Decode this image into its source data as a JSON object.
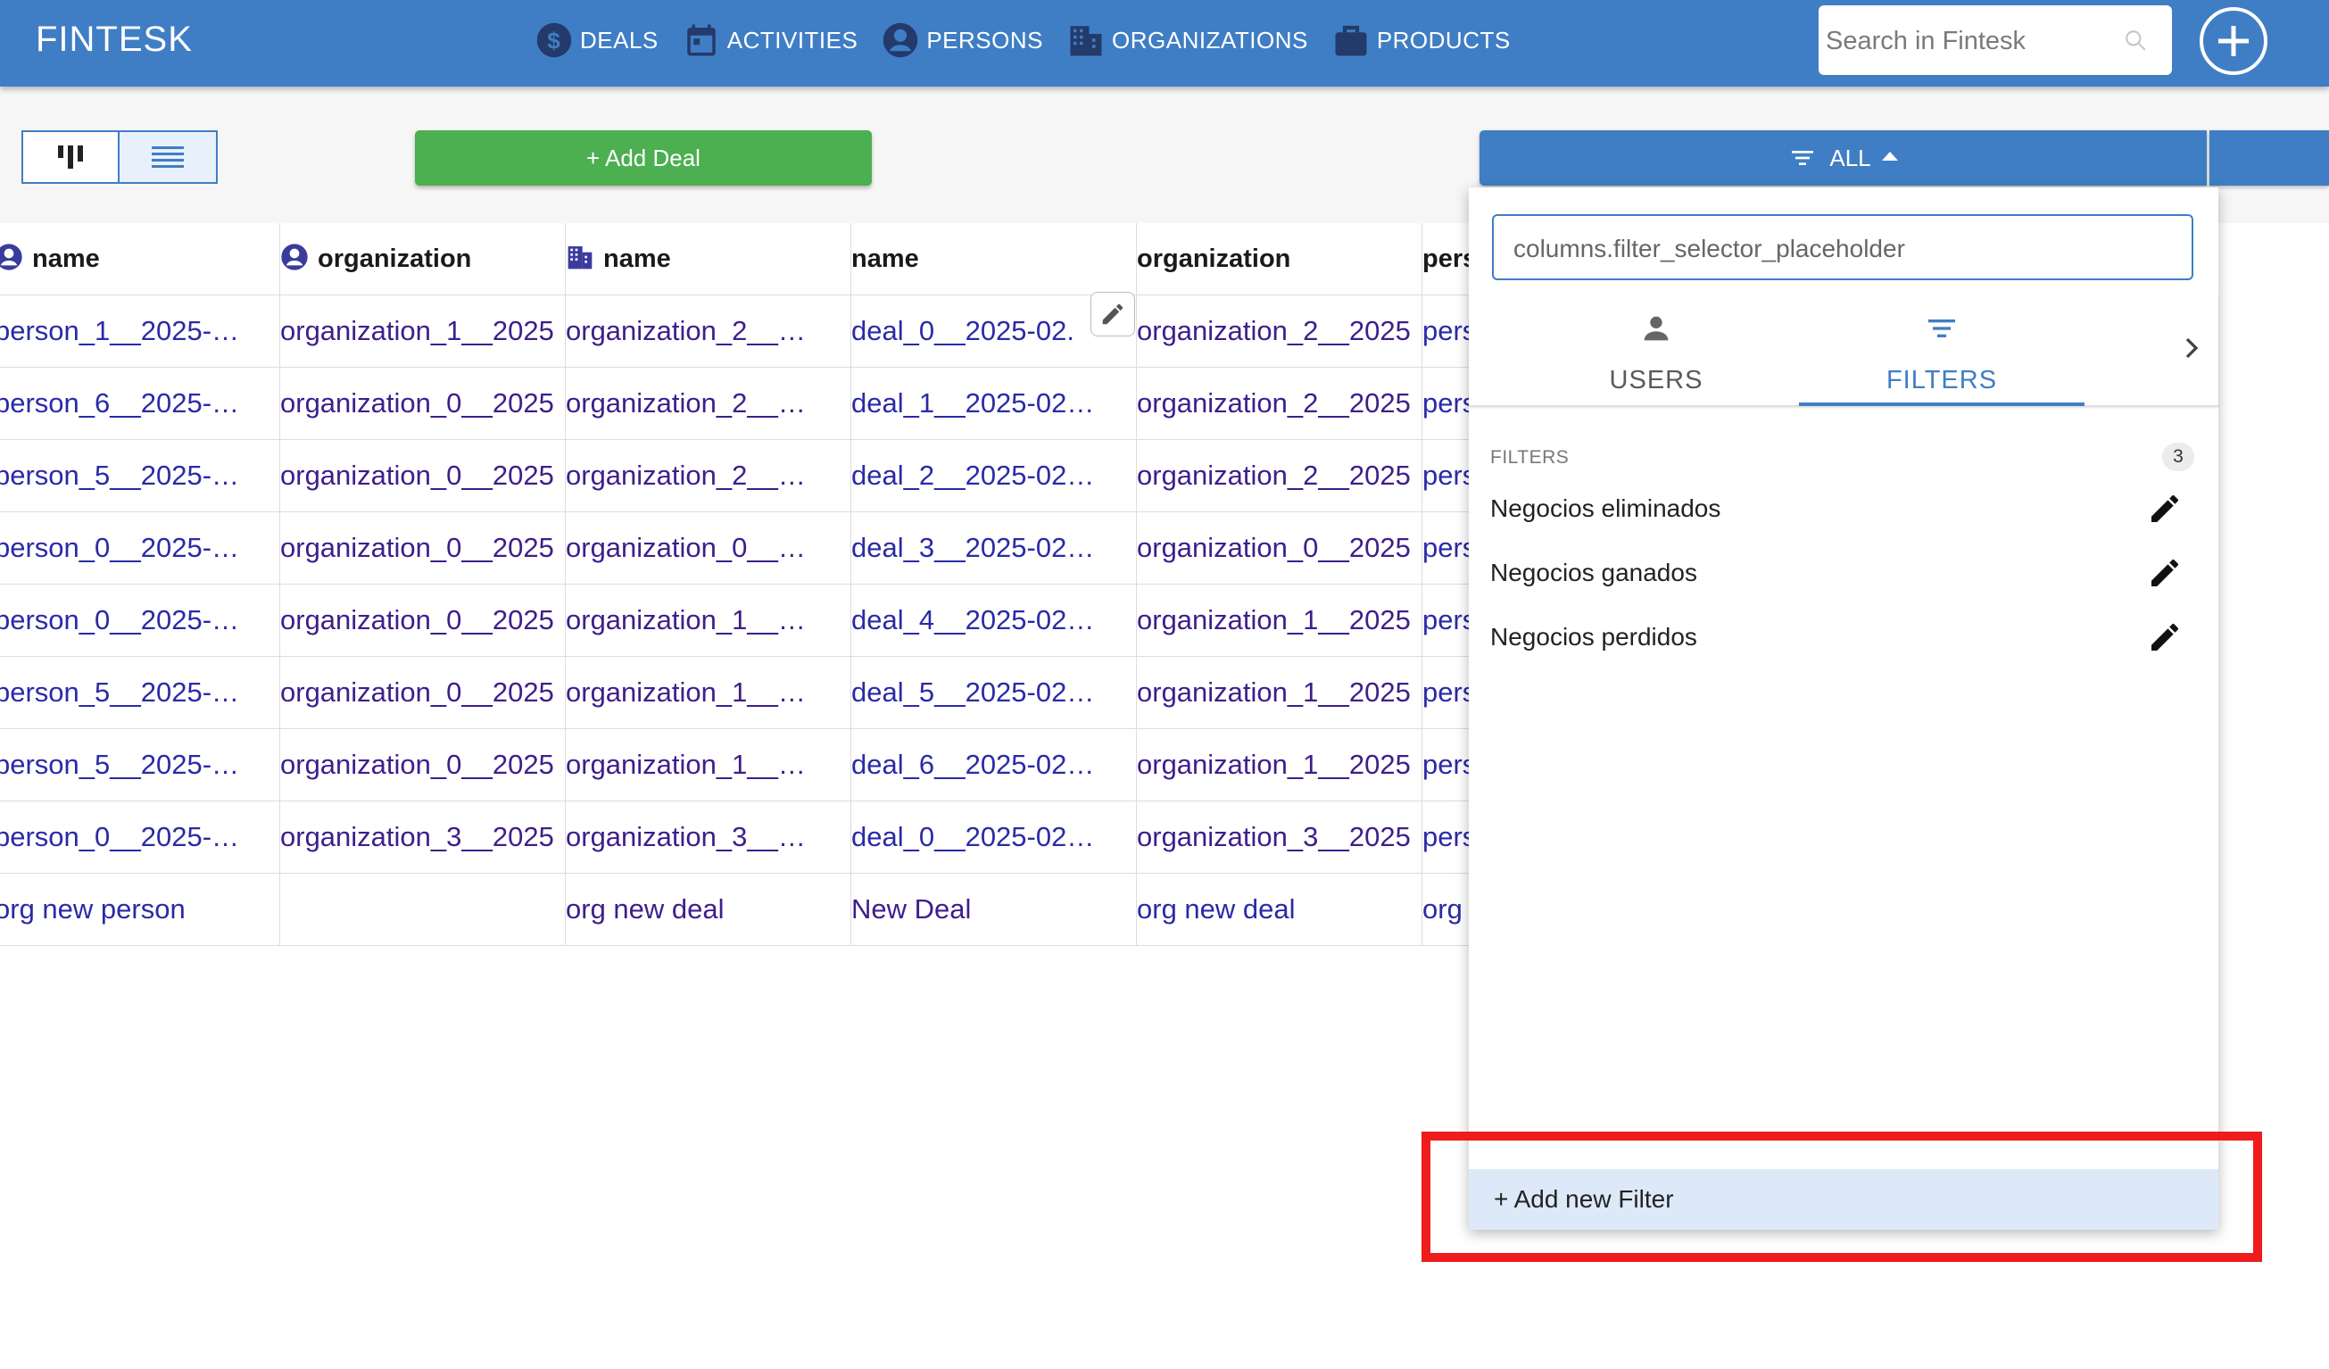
{
  "app": {
    "brand": "FINTESK"
  },
  "nav": [
    {
      "label": "DEALS",
      "icon": "dollar-circle-icon"
    },
    {
      "label": "ACTIVITIES",
      "icon": "calendar-icon"
    },
    {
      "label": "PERSONS",
      "icon": "person-circle-icon"
    },
    {
      "label": "ORGANIZATIONS",
      "icon": "building-icon"
    },
    {
      "label": "PRODUCTS",
      "icon": "briefcase-icon"
    }
  ],
  "search": {
    "placeholder": "Search in Fintesk"
  },
  "toolbar": {
    "add_deal_label": "+ Add Deal",
    "filter_label": "ALL"
  },
  "table": {
    "headers": [
      "name",
      "organization",
      "name",
      "name",
      "organization",
      "pers"
    ],
    "rows": [
      [
        "person_1__2025-…",
        "organization_1__2025",
        "organization_2__…",
        "deal_0__2025-02.",
        "organization_2__2025",
        "pers"
      ],
      [
        "person_6__2025-…",
        "organization_0__2025",
        "organization_2__…",
        "deal_1__2025-02…",
        "organization_2__2025",
        "pers"
      ],
      [
        "person_5__2025-…",
        "organization_0__2025",
        "organization_2__…",
        "deal_2__2025-02…",
        "organization_2__2025",
        "pers"
      ],
      [
        "person_0__2025-…",
        "organization_0__2025",
        "organization_0__…",
        "deal_3__2025-02…",
        "organization_0__2025",
        "pers"
      ],
      [
        "person_0__2025-…",
        "organization_0__2025",
        "organization_1__…",
        "deal_4__2025-02…",
        "organization_1__2025",
        "pers"
      ],
      [
        "person_5__2025-…",
        "organization_0__2025",
        "organization_1__…",
        "deal_5__2025-02…",
        "organization_1__2025",
        "pers"
      ],
      [
        "person_5__2025-…",
        "organization_0__2025",
        "organization_1__…",
        "deal_6__2025-02…",
        "organization_1__2025",
        "pers"
      ],
      [
        "person_0__2025-…",
        "organization_3__2025",
        "organization_3__…",
        "deal_0__2025-02…",
        "organization_3__2025",
        "pers"
      ],
      [
        "org new person",
        "",
        "org new deal",
        "New Deal",
        "org new deal",
        "org"
      ]
    ]
  },
  "filter_panel": {
    "search_placeholder": "columns.filter_selector_placeholder",
    "tabs": [
      {
        "label": "USERS"
      },
      {
        "label": "FILTERS"
      }
    ],
    "section_title": "FILTERS",
    "count": "3",
    "filters": [
      {
        "label": "Negocios eliminados"
      },
      {
        "label": "Negocios ganados"
      },
      {
        "label": "Negocios perdidos"
      }
    ],
    "add_filter_label": "+ Add new Filter"
  },
  "colors": {
    "topbar": "#3f7ec4",
    "add_deal": "#4caf50",
    "link_text": "#2a2aa8",
    "highlight": "#ee1c1c"
  }
}
